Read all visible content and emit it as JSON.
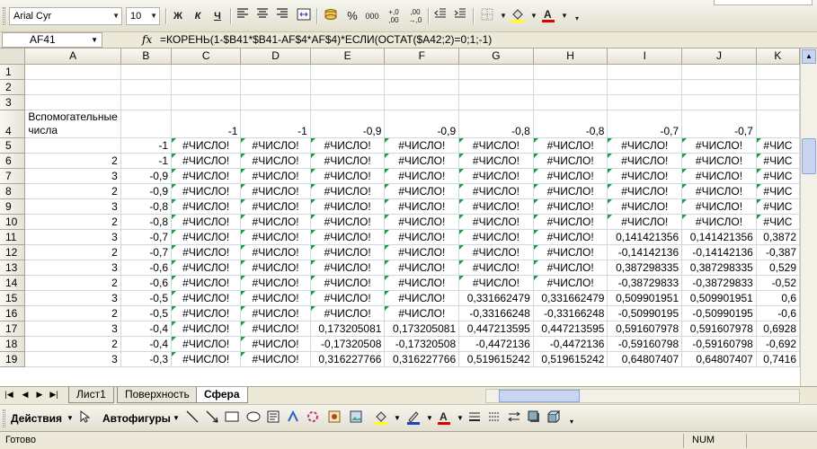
{
  "toolbar": {
    "font_name": "Arial Cyr",
    "font_size": "10",
    "bold_label": "Ж",
    "italic_label": "К",
    "underline_label": "Ч"
  },
  "formula_bar": {
    "cell_ref": "AF41",
    "fx_label": "fx",
    "formula": "=КОРЕНЬ(1-$B41*$B41-AF$4*AF$4)*ЕСЛИ(ОСТАТ($A42;2)=0;1;-1)"
  },
  "columns": [
    "A",
    "B",
    "C",
    "D",
    "E",
    "F",
    "G",
    "H",
    "I",
    "J",
    "K"
  ],
  "header_row4": {
    "A": "Вспомогательные числа",
    "B": "",
    "C": "-1",
    "D": "-1",
    "E": "-0,9",
    "F": "-0,9",
    "G": "-0,8",
    "H": "-0,8",
    "I": "-0,7",
    "J": "-0,7",
    "K": ""
  },
  "rows": [
    {
      "n": "5",
      "a": "",
      "b": "-1",
      "c": "#ЧИСЛО!",
      "d": "#ЧИСЛО!",
      "e": "#ЧИСЛО!",
      "f": "#ЧИСЛО!",
      "g": "#ЧИСЛО!",
      "h": "#ЧИСЛО!",
      "i": "#ЧИСЛО!",
      "j": "#ЧИСЛО!",
      "k": "#ЧИС"
    },
    {
      "n": "6",
      "a": "2",
      "b": "-1",
      "c": "#ЧИСЛО!",
      "d": "#ЧИСЛО!",
      "e": "#ЧИСЛО!",
      "f": "#ЧИСЛО!",
      "g": "#ЧИСЛО!",
      "h": "#ЧИСЛО!",
      "i": "#ЧИСЛО!",
      "j": "#ЧИСЛО!",
      "k": "#ЧИС"
    },
    {
      "n": "7",
      "a": "3",
      "b": "-0,9",
      "c": "#ЧИСЛО!",
      "d": "#ЧИСЛО!",
      "e": "#ЧИСЛО!",
      "f": "#ЧИСЛО!",
      "g": "#ЧИСЛО!",
      "h": "#ЧИСЛО!",
      "i": "#ЧИСЛО!",
      "j": "#ЧИСЛО!",
      "k": "#ЧИС"
    },
    {
      "n": "8",
      "a": "2",
      "b": "-0,9",
      "c": "#ЧИСЛО!",
      "d": "#ЧИСЛО!",
      "e": "#ЧИСЛО!",
      "f": "#ЧИСЛО!",
      "g": "#ЧИСЛО!",
      "h": "#ЧИСЛО!",
      "i": "#ЧИСЛО!",
      "j": "#ЧИСЛО!",
      "k": "#ЧИС"
    },
    {
      "n": "9",
      "a": "3",
      "b": "-0,8",
      "c": "#ЧИСЛО!",
      "d": "#ЧИСЛО!",
      "e": "#ЧИСЛО!",
      "f": "#ЧИСЛО!",
      "g": "#ЧИСЛО!",
      "h": "#ЧИСЛО!",
      "i": "#ЧИСЛО!",
      "j": "#ЧИСЛО!",
      "k": "#ЧИС"
    },
    {
      "n": "10",
      "a": "2",
      "b": "-0,8",
      "c": "#ЧИСЛО!",
      "d": "#ЧИСЛО!",
      "e": "#ЧИСЛО!",
      "f": "#ЧИСЛО!",
      "g": "#ЧИСЛО!",
      "h": "#ЧИСЛО!",
      "i": "#ЧИСЛО!",
      "j": "#ЧИСЛО!",
      "k": "#ЧИС"
    },
    {
      "n": "11",
      "a": "3",
      "b": "-0,7",
      "c": "#ЧИСЛО!",
      "d": "#ЧИСЛО!",
      "e": "#ЧИСЛО!",
      "f": "#ЧИСЛО!",
      "g": "#ЧИСЛО!",
      "h": "#ЧИСЛО!",
      "i": "0,141421356",
      "j": "0,141421356",
      "k": "0,3872"
    },
    {
      "n": "12",
      "a": "2",
      "b": "-0,7",
      "c": "#ЧИСЛО!",
      "d": "#ЧИСЛО!",
      "e": "#ЧИСЛО!",
      "f": "#ЧИСЛО!",
      "g": "#ЧИСЛО!",
      "h": "#ЧИСЛО!",
      "i": "-0,14142136",
      "j": "-0,14142136",
      "k": "-0,387"
    },
    {
      "n": "13",
      "a": "3",
      "b": "-0,6",
      "c": "#ЧИСЛО!",
      "d": "#ЧИСЛО!",
      "e": "#ЧИСЛО!",
      "f": "#ЧИСЛО!",
      "g": "#ЧИСЛО!",
      "h": "#ЧИСЛО!",
      "i": "0,387298335",
      "j": "0,387298335",
      "k": "0,529"
    },
    {
      "n": "14",
      "a": "2",
      "b": "-0,6",
      "c": "#ЧИСЛО!",
      "d": "#ЧИСЛО!",
      "e": "#ЧИСЛО!",
      "f": "#ЧИСЛО!",
      "g": "#ЧИСЛО!",
      "h": "#ЧИСЛО!",
      "i": "-0,38729833",
      "j": "-0,38729833",
      "k": "-0,52"
    },
    {
      "n": "15",
      "a": "3",
      "b": "-0,5",
      "c": "#ЧИСЛО!",
      "d": "#ЧИСЛО!",
      "e": "#ЧИСЛО!",
      "f": "#ЧИСЛО!",
      "g": "0,331662479",
      "h": "0,331662479",
      "i": "0,509901951",
      "j": "0,509901951",
      "k": "0,6"
    },
    {
      "n": "16",
      "a": "2",
      "b": "-0,5",
      "c": "#ЧИСЛО!",
      "d": "#ЧИСЛО!",
      "e": "#ЧИСЛО!",
      "f": "#ЧИСЛО!",
      "g": "-0,33166248",
      "h": "-0,33166248",
      "i": "-0,50990195",
      "j": "-0,50990195",
      "k": "-0,6"
    },
    {
      "n": "17",
      "a": "3",
      "b": "-0,4",
      "c": "#ЧИСЛО!",
      "d": "#ЧИСЛО!",
      "e": "0,173205081",
      "f": "0,173205081",
      "g": "0,447213595",
      "h": "0,447213595",
      "i": "0,591607978",
      "j": "0,591607978",
      "k": "0,6928"
    },
    {
      "n": "18",
      "a": "2",
      "b": "-0,4",
      "c": "#ЧИСЛО!",
      "d": "#ЧИСЛО!",
      "e": "-0,17320508",
      "f": "-0,17320508",
      "g": "-0,4472136",
      "h": "-0,4472136",
      "i": "-0,59160798",
      "j": "-0,59160798",
      "k": "-0,692"
    },
    {
      "n": "19",
      "a": "3",
      "b": "-0,3",
      "c": "#ЧИСЛО!",
      "d": "#ЧИСЛО!",
      "e": "0,316227766",
      "f": "0,316227766",
      "g": "0,519615242",
      "h": "0,519615242",
      "i": "0,64807407",
      "j": "0,64807407",
      "k": "0,7416"
    }
  ],
  "sheet_tabs": [
    "Лист1",
    "Поверхность",
    "Сфера"
  ],
  "active_tab": "Сфера",
  "draw_toolbar": {
    "actions_label": "Действия",
    "autoshapes_label": "Автофигуры"
  },
  "status": {
    "ready": "Готово",
    "num": "NUM"
  }
}
